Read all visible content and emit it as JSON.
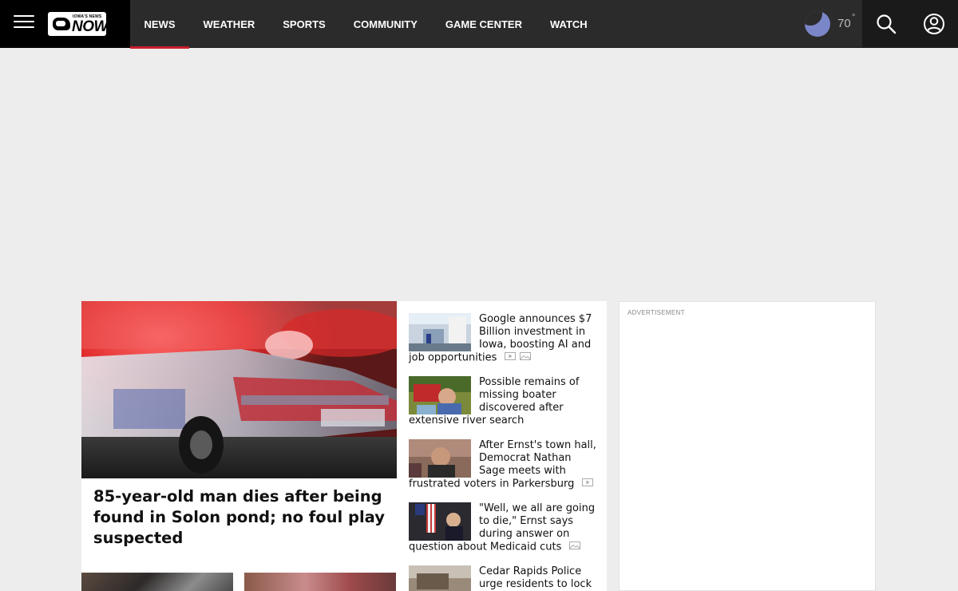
{
  "brand": {
    "logo_small": "IOWA'S NEWS",
    "logo_big": "NOW"
  },
  "nav": {
    "items": [
      "NEWS",
      "WEATHER",
      "SPORTS",
      "COMMUNITY",
      "GAME CENTER",
      "WATCH"
    ],
    "active": "NEWS"
  },
  "weather": {
    "temp": "70",
    "degree": "°",
    "icon": "moon-icon"
  },
  "feature": {
    "title": "85-year-old man dies after being found in Solon pond; no foul play suspected"
  },
  "stories": [
    {
      "headline": "Google announces $7 Billion investment in Iowa, boosting AI and job opportunities",
      "icons": [
        "video-icon",
        "gallery-icon"
      ]
    },
    {
      "headline": "Possible remains of missing boater discovered after extensive river search",
      "icons": []
    },
    {
      "headline": "After Ernst's town hall, Democrat Nathan Sage meets with frustrated voters in Parkersburg",
      "icons": [
        "video-icon"
      ]
    },
    {
      "headline": "\"Well, we all are going to die,\" Ernst says during answer on question about Medicaid cuts",
      "icons": [
        "gallery-icon"
      ]
    },
    {
      "headline": "Cedar Rapids Police urge residents to lock",
      "icons": []
    }
  ],
  "ad": {
    "label": "ADVERTISEMENT"
  },
  "colors": {
    "header_bg": "#2b2b2b",
    "brand_bg": "#000000",
    "accent": "#cc1f2e",
    "moon": "#7b86c9",
    "page_bg": "#ededed"
  }
}
